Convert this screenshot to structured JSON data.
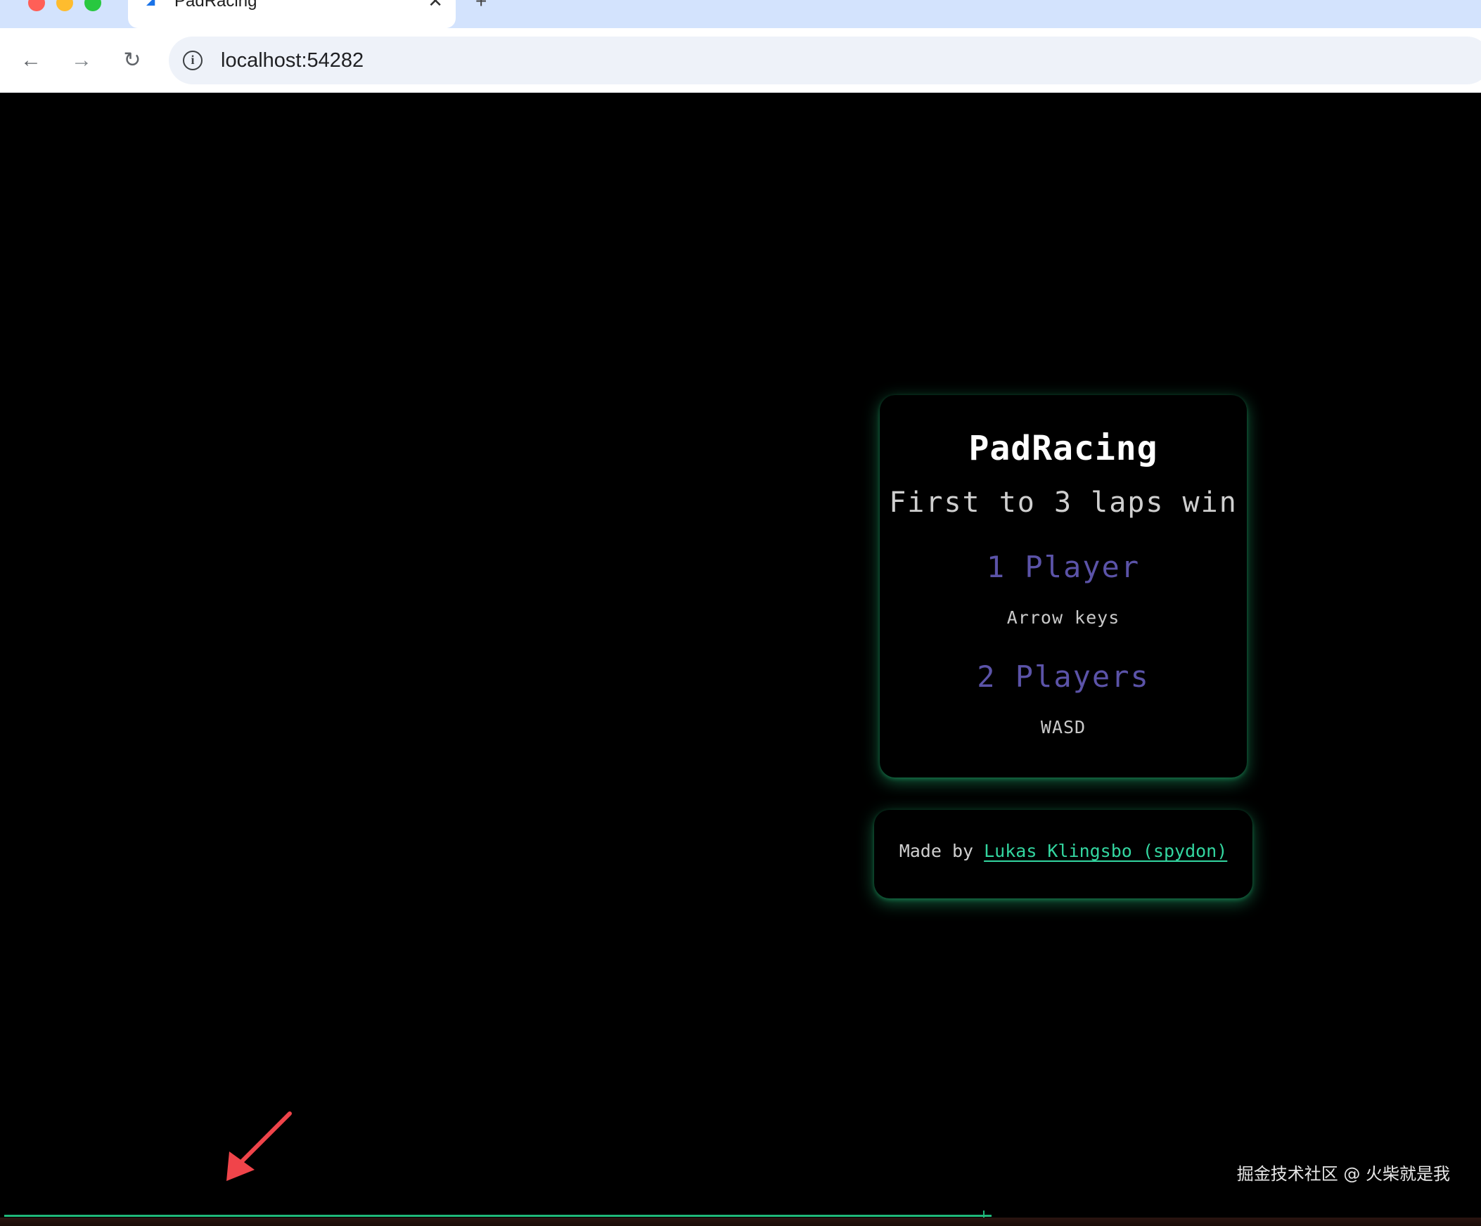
{
  "browser": {
    "tab_title": "PadRacing",
    "tab_close": "✕",
    "new_tab": "+",
    "url": "localhost:54282",
    "back": "←",
    "forward": "→",
    "reload": "↻",
    "info": "i"
  },
  "menu": {
    "title": "PadRacing",
    "subtitle": "First to 3 laps win",
    "modes": [
      {
        "label": "1 Player",
        "hint": "Arrow keys"
      },
      {
        "label": "2 Players",
        "hint": "WASD"
      }
    ]
  },
  "credits": {
    "prefix": "Made by ",
    "author": "Lukas Klingsbo (spydon)"
  },
  "watermark": "掘金技术社区 @ 火柴就是我",
  "colors": {
    "accent_green": "#33d6a0",
    "mode_purple": "#5b53a8",
    "arrow_red": "#f0444a"
  }
}
